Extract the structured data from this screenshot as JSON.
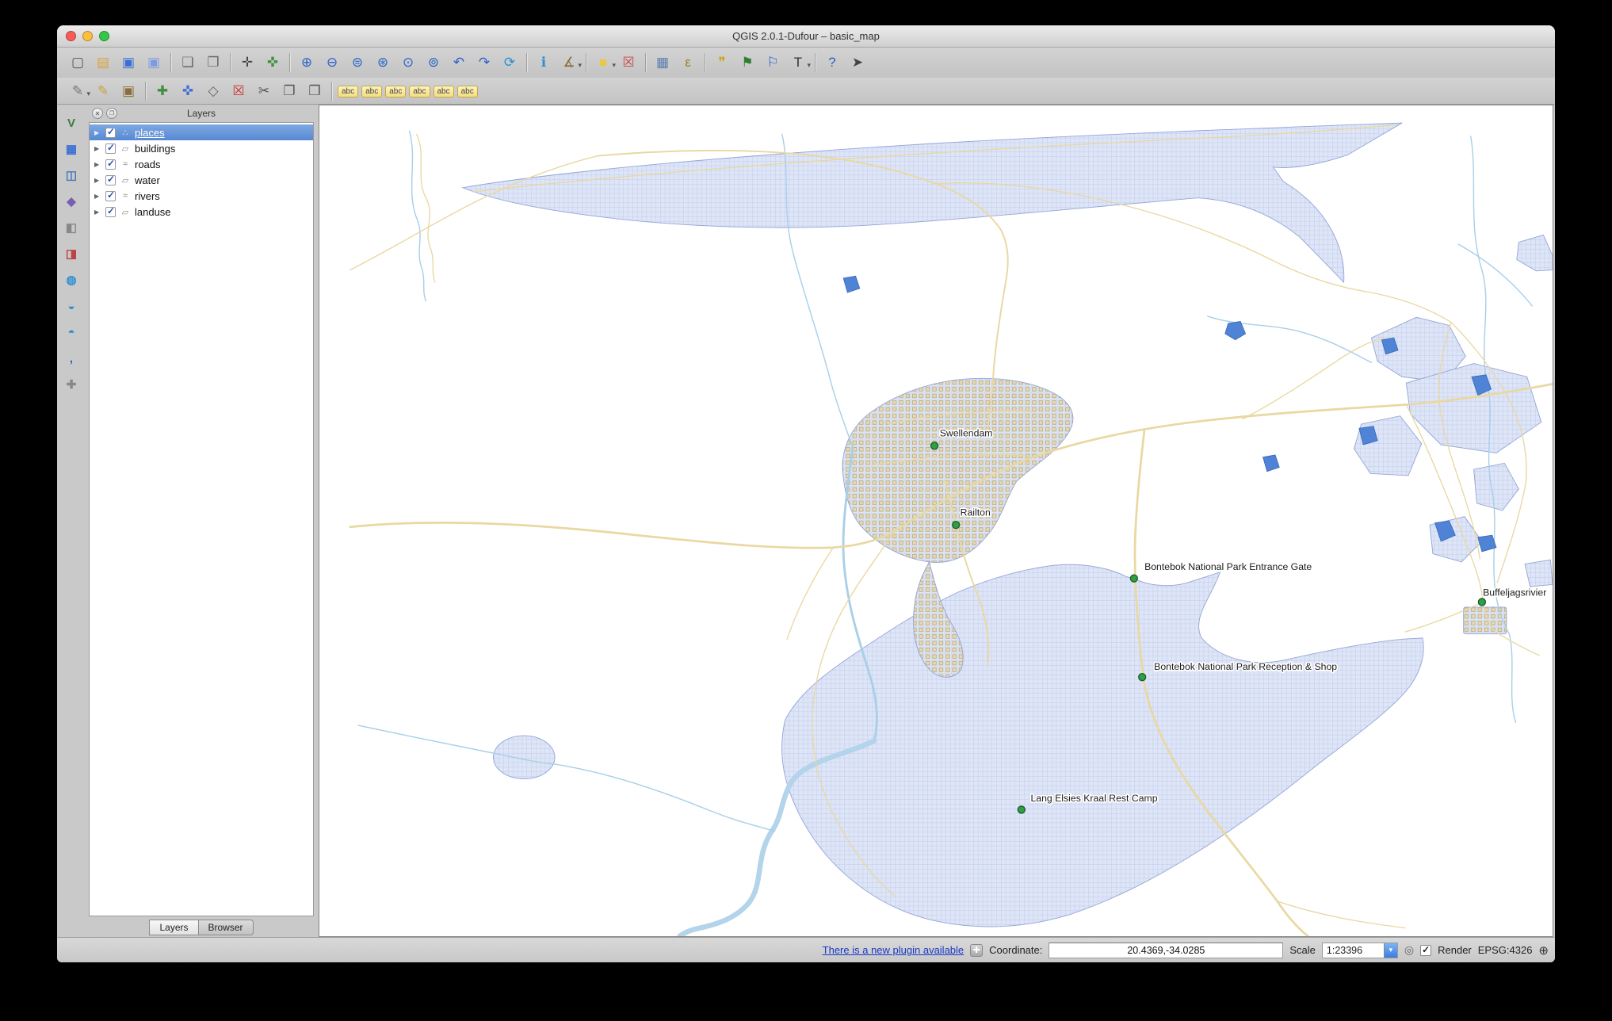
{
  "window": {
    "title": "QGIS 2.0.1-Dufour – basic_map",
    "controls": [
      {
        "id": "close-button",
        "bg": "#fc5b57"
      },
      {
        "id": "minimize-button",
        "bg": "#fdbe3d"
      },
      {
        "id": "zoom-button",
        "bg": "#33c748"
      }
    ]
  },
  "toolbar_main": [
    {
      "id": "new-project-button",
      "glyph": "▢",
      "color": "#555555"
    },
    {
      "id": "open-project-button",
      "glyph": "▤",
      "color": "#d9a43b"
    },
    {
      "id": "save-project-button",
      "glyph": "▣",
      "color": "#3b6fd4"
    },
    {
      "id": "save-project-as-button",
      "glyph": "▣",
      "color": "#7d9ce0"
    },
    {
      "sep": true
    },
    {
      "id": "new-composer-button",
      "glyph": "❏",
      "color": "#666666"
    },
    {
      "id": "composer-manager-button",
      "glyph": "❐",
      "color": "#666666"
    },
    {
      "sep": true
    },
    {
      "id": "pan-map-button",
      "glyph": "✛",
      "color": "#444444"
    },
    {
      "id": "pan-to-selection-button",
      "glyph": "✜",
      "color": "#3f8f3f"
    },
    {
      "sep": true
    },
    {
      "id": "zoom-in-button",
      "glyph": "⊕",
      "color": "#2a62c9"
    },
    {
      "id": "zoom-out-button",
      "glyph": "⊖",
      "color": "#2a62c9"
    },
    {
      "id": "zoom-actual-button",
      "glyph": "⊜",
      "color": "#2a62c9"
    },
    {
      "id": "zoom-full-button",
      "glyph": "⊛",
      "color": "#2a62c9"
    },
    {
      "id": "zoom-to-selection-button",
      "glyph": "⊙",
      "color": "#2a62c9"
    },
    {
      "id": "zoom-to-layer-button",
      "glyph": "⊚",
      "color": "#2a62c9"
    },
    {
      "id": "zoom-last-button",
      "glyph": "↶",
      "color": "#2a62c9"
    },
    {
      "id": "zoom-next-button",
      "glyph": "↷",
      "color": "#2a62c9"
    },
    {
      "id": "refresh-button",
      "glyph": "⟳",
      "color": "#2a8fd4"
    },
    {
      "sep": true
    },
    {
      "id": "identify-button",
      "glyph": "ℹ",
      "color": "#2a8fd4"
    },
    {
      "id": "measure-button",
      "glyph": "∡",
      "color": "#8a6d3b",
      "dropdown": true
    },
    {
      "sep": true
    },
    {
      "id": "select-features-button",
      "glyph": "■",
      "color": "#e8c84a",
      "dropdown": true
    },
    {
      "id": "deselect-features-button",
      "glyph": "☒",
      "color": "#cc4444"
    },
    {
      "sep": true
    },
    {
      "id": "attribute-table-button",
      "glyph": "▦",
      "color": "#5a7fb0"
    },
    {
      "id": "field-calculator-button",
      "glyph": "ε",
      "color": "#9a7d2e"
    },
    {
      "sep": true
    },
    {
      "id": "map-tips-button",
      "glyph": "❞",
      "color": "#d4a017"
    },
    {
      "id": "new-bookmark-button",
      "glyph": "⚑",
      "color": "#2f7d32"
    },
    {
      "id": "show-bookmarks-button",
      "glyph": "⚐",
      "color": "#2a62c9"
    },
    {
      "id": "text-annotation-button",
      "glyph": "T",
      "color": "#333333",
      "dropdown": true
    },
    {
      "sep": true
    },
    {
      "id": "help-button",
      "glyph": "?",
      "color": "#2a62c9"
    },
    {
      "id": "whats-this-button",
      "glyph": "➤",
      "color": "#444444"
    }
  ],
  "toolbar_edit": [
    {
      "id": "current-edits-button",
      "glyph": "✎",
      "color": "#777777",
      "dropdown": true
    },
    {
      "id": "toggle-editing-button",
      "glyph": "✎",
      "color": "#caa23a"
    },
    {
      "id": "save-layer-edits-button",
      "glyph": "▣",
      "color": "#8a6d3b"
    },
    {
      "sep": true
    },
    {
      "id": "add-feature-button",
      "glyph": "✚",
      "color": "#3f8f3f"
    },
    {
      "id": "move-feature-button",
      "glyph": "✜",
      "color": "#3b6fd4"
    },
    {
      "id": "node-tool-button",
      "glyph": "◇",
      "color": "#666666"
    },
    {
      "id": "delete-selected-button",
      "glyph": "☒",
      "color": "#cc3333"
    },
    {
      "id": "cut-features-button",
      "glyph": "✂",
      "color": "#555555"
    },
    {
      "id": "copy-features-button",
      "glyph": "❐",
      "color": "#555555"
    },
    {
      "id": "paste-features-button",
      "glyph": "❒",
      "color": "#555555"
    }
  ],
  "toolbar_label": [
    {
      "id": "labeling-button",
      "text": "abc"
    },
    {
      "id": "label-pin-button",
      "text": "abc"
    },
    {
      "id": "label-show-hide-button",
      "text": "abc"
    },
    {
      "id": "label-move-button",
      "text": "abc"
    },
    {
      "id": "label-rotate-button",
      "text": "abc"
    },
    {
      "id": "label-properties-button",
      "text": "abc"
    }
  ],
  "toolbar_left": [
    {
      "id": "add-vector-layer-button",
      "glyph": "V",
      "color": "#3a7d3a"
    },
    {
      "id": "add-raster-layer-button",
      "glyph": "▦",
      "color": "#3b6fd4"
    },
    {
      "id": "add-postgis-layer-button",
      "glyph": "◫",
      "color": "#4477bb"
    },
    {
      "id": "add-spatialite-layer-button",
      "glyph": "◆",
      "color": "#7a5fb0"
    },
    {
      "id": "add-mssql-layer-button",
      "glyph": "◧",
      "color": "#888888"
    },
    {
      "id": "add-oracle-layer-button",
      "glyph": "◨",
      "color": "#bb4444"
    },
    {
      "id": "add-wms-layer-button",
      "glyph": "◍",
      "color": "#2a8fd4"
    },
    {
      "id": "add-wcs-layer-button",
      "glyph": "◒",
      "color": "#2a8fd4"
    },
    {
      "id": "add-wfs-layer-button",
      "glyph": "◓",
      "color": "#2a8fd4"
    },
    {
      "id": "add-delimited-text-layer-button",
      "glyph": ",",
      "color": "#2a62c9"
    },
    {
      "id": "new-shapefile-layer-button",
      "glyph": "✚",
      "color": "#888888"
    }
  ],
  "layers_panel": {
    "title": "Layers",
    "layers": [
      {
        "id": "layer-row-places",
        "name": "places",
        "glyph": "∴",
        "checked": true,
        "selected": true
      },
      {
        "id": "layer-row-buildings",
        "name": "buildings",
        "glyph": "▱",
        "checked": true
      },
      {
        "id": "layer-row-roads",
        "name": "roads",
        "glyph": "≈",
        "checked": true
      },
      {
        "id": "layer-row-water",
        "name": "water",
        "glyph": "▱",
        "checked": true
      },
      {
        "id": "layer-row-rivers",
        "name": "rivers",
        "glyph": "≈",
        "checked": true
      },
      {
        "id": "layer-row-landuse",
        "name": "landuse",
        "glyph": "▱",
        "checked": true
      }
    ],
    "tabs": [
      {
        "id": "tab-layers",
        "label": "Layers",
        "active": true
      },
      {
        "id": "tab-browser",
        "label": "Browser"
      }
    ]
  },
  "map": {
    "labels": [
      {
        "name": "Swellendam"
      },
      {
        "name": "Railton"
      },
      {
        "name": "Bontebok National Park Entrance Gate"
      },
      {
        "name": "Buffeljagsrivier"
      },
      {
        "name": "Bontebok National Park Reception & Shop"
      },
      {
        "name": "Lang Elsies Kraal Rest Camp"
      }
    ],
    "colors": {
      "landuse_fill": "#dee5f6",
      "landuse_hatch": "#b7c4ec",
      "landuse_stroke": "#94a5d8",
      "building_fill": "#e6d9ad",
      "road": "#e9d8a2",
      "river": "#a9cfe8",
      "water_fill": "#4f83d6",
      "place_marker": "#2f9e45",
      "label_text": "#1c1c1c"
    }
  },
  "status": {
    "plugin_link": "There is a new plugin available",
    "coordinate_label": "Coordinate:",
    "coordinate_value": "20.4369,-34.0285",
    "scale_label": "Scale",
    "scale_value": "1:23396",
    "render_label": "Render",
    "crs": "EPSG:4326"
  }
}
